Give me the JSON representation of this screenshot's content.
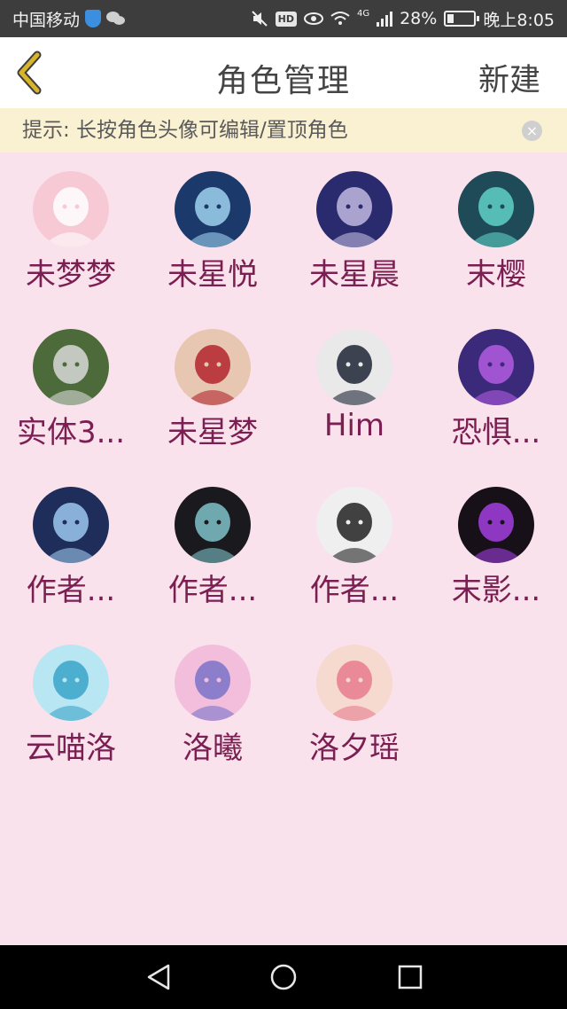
{
  "status": {
    "carrier": "中国移动",
    "battery": "28%",
    "time": "晚上8:05",
    "network": "4G",
    "hd": "HD"
  },
  "navbar": {
    "title": "角色管理",
    "new_label": "新建"
  },
  "hint": {
    "text": "提示: 长按角色头像可编辑/置顶角色",
    "close": "×"
  },
  "roles": [
    {
      "name": "未梦梦",
      "avatar_bg": "#f7c9d4",
      "avatar_accent": "#ffffff"
    },
    {
      "name": "未星悦",
      "avatar_bg": "#1b3a6b",
      "avatar_accent": "#9fd2ee"
    },
    {
      "name": "未星晨",
      "avatar_bg": "#2a2b6e",
      "avatar_accent": "#c2b9e0"
    },
    {
      "name": "末樱",
      "avatar_bg": "#1f4a57",
      "avatar_accent": "#5fd1c7"
    },
    {
      "name": "实体3...",
      "avatar_bg": "#4d6b3a",
      "avatar_accent": "#d8d8d8"
    },
    {
      "name": "未星梦",
      "avatar_bg": "#e7c6b2",
      "avatar_accent": "#b3242e"
    },
    {
      "name": "Him",
      "avatar_bg": "#e9e9ea",
      "avatar_accent": "#1e2436"
    },
    {
      "name": "恐惧...",
      "avatar_bg": "#3b2a79",
      "avatar_accent": "#b35ce0"
    },
    {
      "name": "作者...",
      "avatar_bg": "#1e2d59",
      "avatar_accent": "#9cc8ef"
    },
    {
      "name": "作者...",
      "avatar_bg": "#1a1a1e",
      "avatar_accent": "#7fc2c9"
    },
    {
      "name": "作者...",
      "avatar_bg": "#efefef",
      "avatar_accent": "#222222"
    },
    {
      "name": "末影...",
      "avatar_bg": "#171019",
      "avatar_accent": "#a23ee0"
    },
    {
      "name": "云喵洛",
      "avatar_bg": "#b9e6f3",
      "avatar_accent": "#3aa4c8"
    },
    {
      "name": "洛曦",
      "avatar_bg": "#f3bedb",
      "avatar_accent": "#7a73c9"
    },
    {
      "name": "洛夕瑶",
      "avatar_bg": "#f6d9cf",
      "avatar_accent": "#e87b8f"
    }
  ],
  "icons": {
    "back": "chevron-left-icon",
    "close": "close-icon",
    "nav_back": "triangle-back-icon",
    "nav_home": "circle-home-icon",
    "nav_recent": "square-recent-icon"
  },
  "colors": {
    "page_bg": "#f9e2ec",
    "name_text": "#7b1f52",
    "back_arrow": "#d8b42a",
    "hint_bg": "#faf0d2"
  }
}
